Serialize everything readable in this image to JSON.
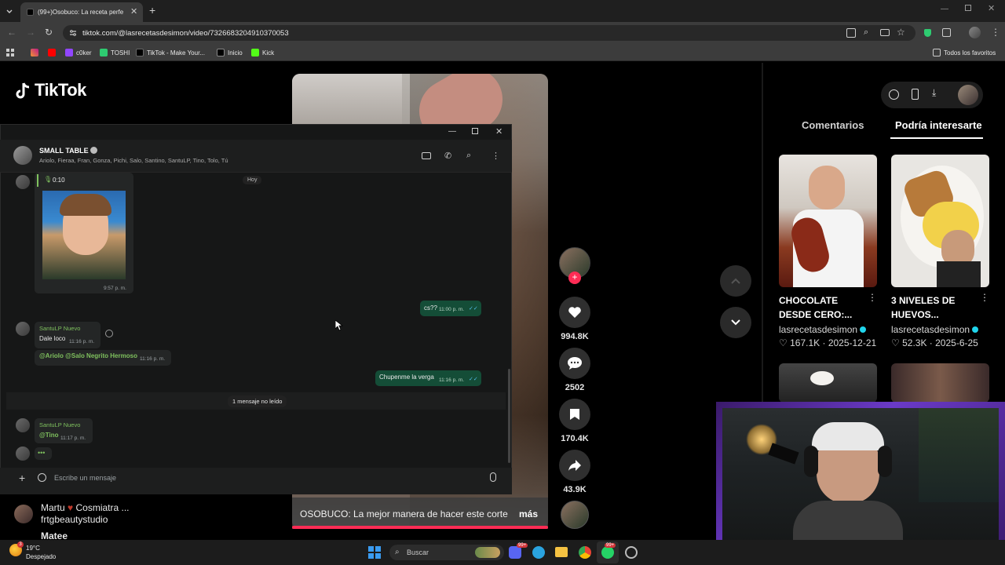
{
  "browser": {
    "tab_title": "(99+)Osobuco: La receta perfe",
    "url": "tiktok.com/@lasrecetasdesimon/video/7326683204910370053",
    "bookmarks": [
      "c0ker",
      "TOSHI",
      "TikTok - Make Your...",
      "Inicio",
      "Kick"
    ],
    "all_bookmarks": "Todos los favoritos"
  },
  "tiktok": {
    "logo": "TikTok",
    "caption": "OSOBUCO: La mejor manera de hacer este corte",
    "more": "más",
    "likes": "994.8K",
    "comments": "2502",
    "saves": "170.4K",
    "shares": "43.9K",
    "tabs": {
      "comments": "Comentarios",
      "interest": "Podría interesarte"
    },
    "cards": [
      {
        "title": "CHOCOLATE DESDE CERO:...",
        "author": "lasrecetasdesimon",
        "likes": "167.1K",
        "date": "2025-12-21"
      },
      {
        "title": "3 NIVELES DE HUEVOS...",
        "author": "lasrecetasdesimon",
        "likes": "52.3K",
        "date": "2025-6-25"
      }
    ],
    "sidebar": {
      "user_line1": "Martu",
      "user_line1b": "Cosmiatra ...",
      "user_line2": "frtgbeautystudio",
      "user_line3": "Matee"
    },
    "colors": {
      "accent": "#fe2c55",
      "verified": "#20d5ec"
    }
  },
  "whatsapp": {
    "group_name": "SMALL TABLE",
    "members": "Ariolo, Fieraa, Fran, Gonza, Pichi, Salo, Santino, SantuLP, Tino, Tolo, Tú",
    "voice_duration": "0:10",
    "date_label": "Hoy",
    "messages": [
      {
        "time": "9:57 p. m."
      },
      {
        "text": "cs??",
        "time": "11:00 p. m."
      },
      {
        "sender": "SantuLP Nuevo",
        "text": "Dale loco",
        "time": "11:16 p. m."
      },
      {
        "text": "@Ariolo @Salo Negrito Hermoso",
        "time": "11:16 p. m."
      },
      {
        "text": "Chupenme la verga",
        "time": "11:16 p. m."
      },
      {
        "sender": "SantuLP Nuevo",
        "text": "@Tino",
        "time": "11:17 p. m."
      }
    ],
    "unread": "1 mensaje no leído",
    "input_placeholder": "Escribe un mensaje",
    "typing": "•••",
    "colors": {
      "out_bubble": "#144d37",
      "name": "#7fc15e",
      "mention": "#53bdeb"
    }
  },
  "taskbar": {
    "temperature": "19°C",
    "weather": "Despejado",
    "search": "Buscar",
    "badge": "99+"
  }
}
